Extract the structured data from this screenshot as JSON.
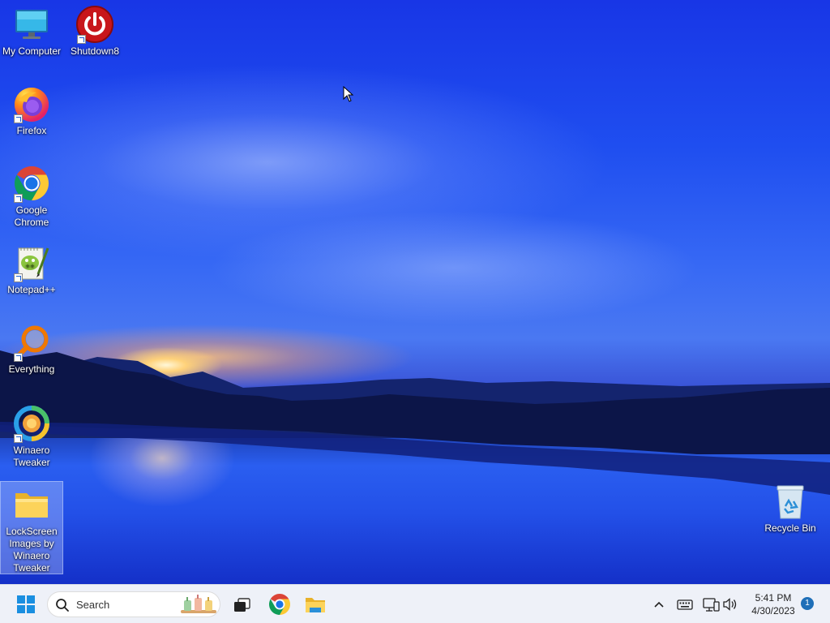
{
  "desktop": {
    "icons": [
      {
        "label": "My Computer",
        "icon": "computer-monitor-icon"
      },
      {
        "label": "Shutdown8",
        "icon": "power-icon"
      },
      {
        "label": "Firefox",
        "icon": "firefox-icon"
      },
      {
        "label": "Google Chrome",
        "icon": "chrome-icon"
      },
      {
        "label": "Notepad++",
        "icon": "notepadpp-icon"
      },
      {
        "label": "Everything",
        "icon": "everything-search-icon"
      },
      {
        "label": "Winaero Tweaker",
        "icon": "winaero-tweaker-icon"
      },
      {
        "label": "LockScreen Images by Winaero Tweaker",
        "icon": "folder-icon"
      },
      {
        "label": "Recycle Bin",
        "icon": "recycle-bin-icon"
      }
    ]
  },
  "taskbar": {
    "start_icon": "windows-logo-icon",
    "search": {
      "placeholder": "Search"
    },
    "pinned": [
      {
        "name": "Task View",
        "icon": "task-view-icon"
      },
      {
        "name": "Google Chrome",
        "icon": "chrome-icon"
      },
      {
        "name": "File Explorer",
        "icon": "file-explorer-icon"
      }
    ],
    "tray": {
      "chevron_icon": "chevron-up-icon",
      "keyboard_icon": "keyboard-icon",
      "network_icon": "network-icon",
      "volume_icon": "speaker-icon",
      "time": "5:41 PM",
      "date": "4/30/2023",
      "notification_count": "1"
    }
  },
  "colors": {
    "taskbar_bg": "#eef1f8",
    "accent": "#1f6fb8",
    "sky": "#1f4ef0"
  }
}
